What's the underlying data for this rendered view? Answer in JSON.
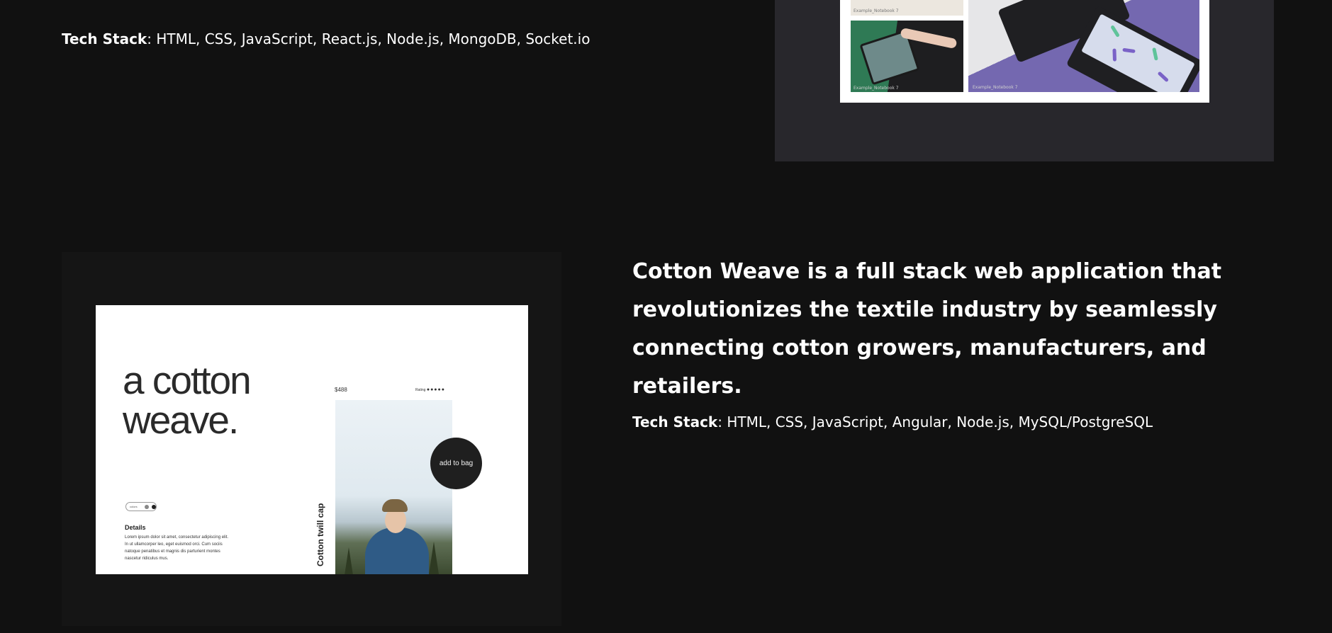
{
  "project_top": {
    "tech_stack_label": "Tech Stack",
    "tech_stack_value": ": HTML, CSS, JavaScript, React.js, Node.js, MongoDB, Socket.io",
    "tile_caption_1": "Example_Notebook 7",
    "tile_caption_2": "Example_Notebook 7",
    "tile_caption_3": "Example_Notebook 7"
  },
  "project_cotton": {
    "hero_text": "a cotton weave.",
    "price": "$488",
    "rating_label": "Rating",
    "rating_stars": "●●●●●",
    "add_to_bag": "add to bag",
    "vertical_title": "Cotton twill cap",
    "toggle_label": "colors",
    "details_title": "Details",
    "details_body": "Lorem ipsum dolor sit amet, consectetur adipiscing elit. In ut ullamcorper leo, eget euismod orci. Cum sociis natoque penatibus et magnis dis parturient montes nascetur ridiculus mus.",
    "description": "Cotton Weave is a full stack web application that revolutionizes the textile industry by seamlessly connecting cotton growers, manufacturers, and retailers.",
    "tech_stack_label": "Tech Stack",
    "tech_stack_value": ": HTML, CSS, JavaScript, Angular, Node.js, MySQL/PostgreSQL"
  },
  "colors": {
    "page_bg": "#111111",
    "frame_top_bg": "#28272c",
    "frame_bottom_bg": "#151515",
    "text": "#ffffff"
  }
}
